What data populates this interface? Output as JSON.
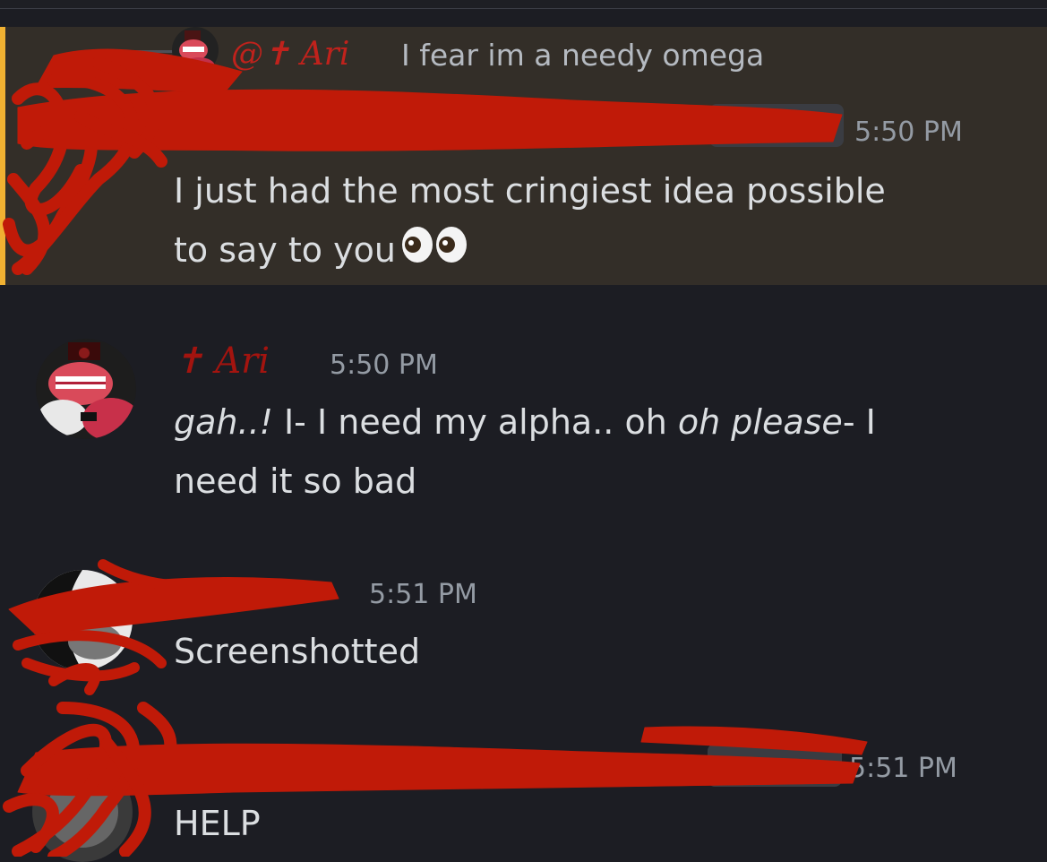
{
  "reply": {
    "mention": "@✝ Ari",
    "text": "I fear im a needy omega"
  },
  "messages": [
    {
      "timestamp": "5:50 PM",
      "lines": [
        "I just had the most cringiest idea possible",
        "to say to you"
      ],
      "emoji": "eyes-emoji"
    },
    {
      "username": "✝ Ari",
      "timestamp": "5:50 PM",
      "line1_a": "gah..!",
      "line1_b": " I- I need my alpha.. oh ",
      "line1_c": "oh please",
      "line1_d": "- I",
      "line2": "need it so bad"
    },
    {
      "timestamp": "5:51 PM",
      "text": "Screenshotted"
    },
    {
      "timestamp": "5:51 PM",
      "text": "HELP"
    }
  ],
  "colors": {
    "background": "#1c1d23",
    "highlight": "#332e28",
    "highlight_bar": "#f0b132",
    "username_red": "#a3140f",
    "redaction": "#c01a08"
  },
  "icons": [
    "ari-avatar",
    "eyes-emoji",
    "redacted-avatar"
  ]
}
